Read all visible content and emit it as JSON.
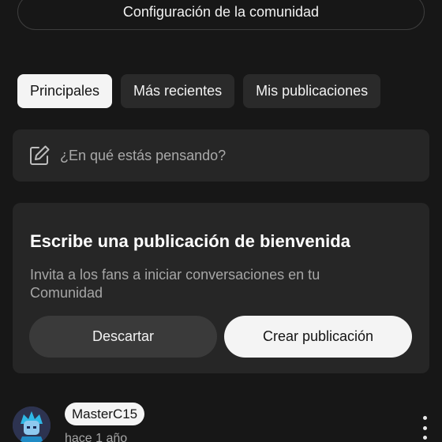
{
  "community_config": {
    "label": "Configuración de la comunidad"
  },
  "tabs": [
    {
      "label": "Principales",
      "active": true
    },
    {
      "label": "Más recientes",
      "active": false
    },
    {
      "label": "Mis publicaciones",
      "active": false
    }
  ],
  "composer": {
    "icon": "pencil-square-icon",
    "placeholder": "¿En qué estás pensando?"
  },
  "welcome_card": {
    "title": "Escribe una publicación de bienvenida",
    "description": "Invita a los fans a iniciar conversaciones en tu Comunidad",
    "dismiss_label": "Descartar",
    "create_label": "Crear publicación"
  },
  "post": {
    "username": "MasterC15",
    "timestamp": "hace 1 año",
    "more_icon": "more-vertical-icon"
  },
  "colors": {
    "background": "#171717",
    "card": "#262626",
    "accent_light": "#f4f4f4",
    "muted_text": "#a6a6a6"
  }
}
